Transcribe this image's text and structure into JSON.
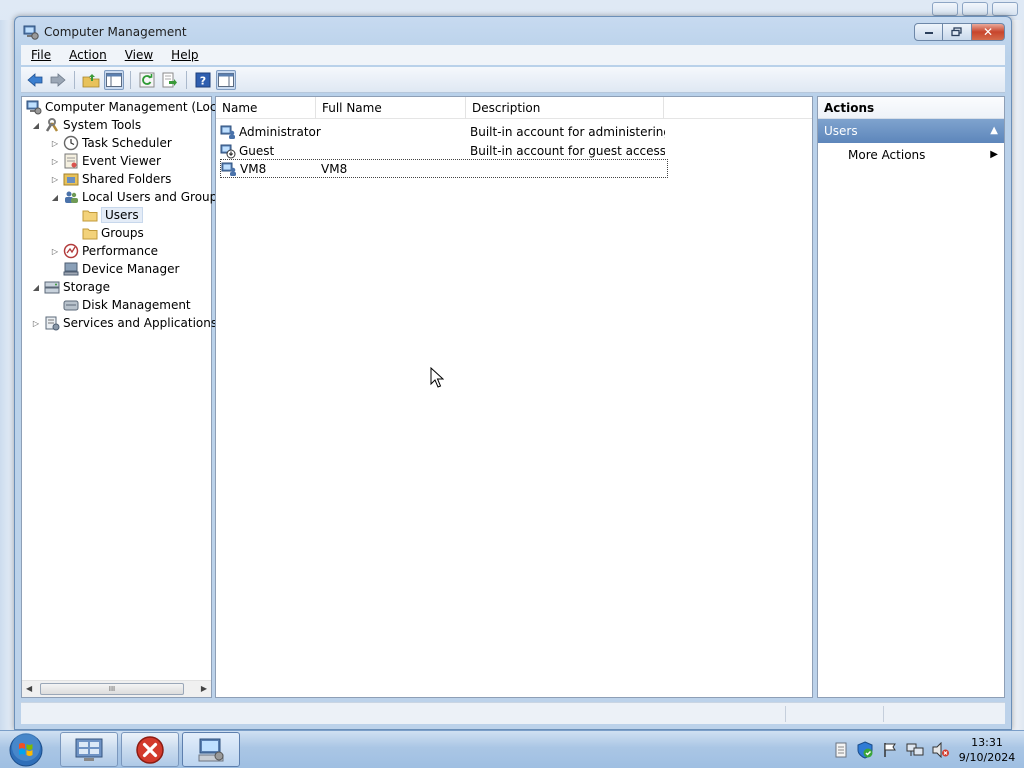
{
  "window": {
    "title": "Computer Management",
    "min_icon": "minimize-icon",
    "max_icon": "maximize-icon",
    "close_label": "✕"
  },
  "menu": {
    "file": "File",
    "action": "Action",
    "view": "View",
    "help": "Help"
  },
  "toolbar": {
    "icons": [
      "back-arrow-icon",
      "forward-arrow-icon",
      "up-folder-icon",
      "show-hide-console-tree-icon",
      "refresh-icon",
      "export-list-icon",
      "help-icon",
      "show-hide-action-pane-icon"
    ]
  },
  "tree": {
    "root": "Computer Management (Local",
    "system_tools": "System Tools",
    "task_scheduler": "Task Scheduler",
    "event_viewer": "Event Viewer",
    "shared_folders": "Shared Folders",
    "local_users_groups": "Local Users and Groups",
    "users": "Users",
    "groups": "Groups",
    "performance": "Performance",
    "device_manager": "Device Manager",
    "storage": "Storage",
    "disk_management": "Disk Management",
    "services_apps": "Services and Applications",
    "scroll_grip": "III"
  },
  "list": {
    "columns": [
      "Name",
      "Full Name",
      "Description"
    ],
    "rows": [
      {
        "name": "Administrator",
        "full_name": "",
        "description": "Built-in account for administering..."
      },
      {
        "name": "Guest",
        "full_name": "",
        "description": "Built-in account for guest access t..."
      },
      {
        "name": "VM8",
        "full_name": "VM8",
        "description": ""
      }
    ]
  },
  "actions": {
    "title": "Actions",
    "section": "Users",
    "more_actions": "More Actions"
  },
  "taskbar": {
    "time": "13:31",
    "date": "9/10/2024"
  },
  "colors": {
    "accent": "#5d86bb",
    "close_red": "#c8452c"
  }
}
